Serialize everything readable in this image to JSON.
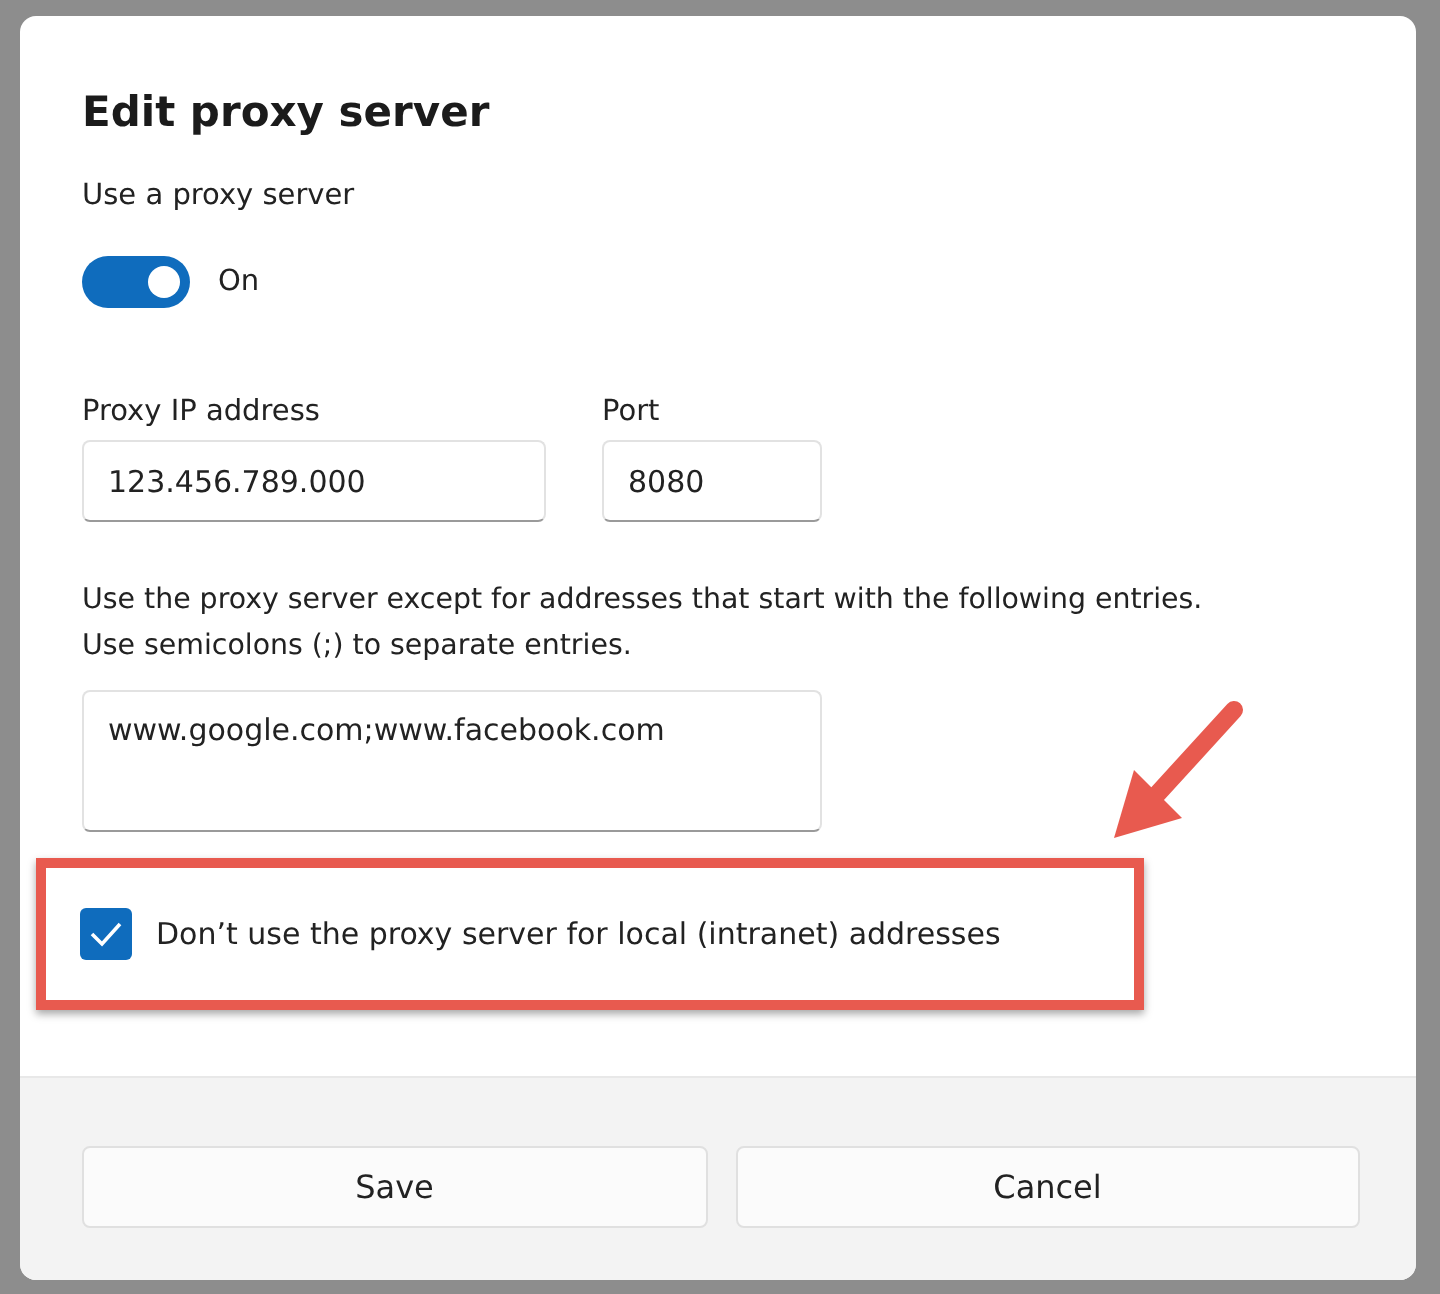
{
  "dialog": {
    "title": "Edit proxy server",
    "proxy_toggle": {
      "label": "Use a proxy server",
      "on": true,
      "state_text": "On"
    },
    "fields": [
      {
        "label": "Proxy IP address",
        "value": "123.456.789.000"
      },
      {
        "label": "Port",
        "value": "8080"
      }
    ],
    "exceptions": {
      "description_lines": [
        "Use the proxy server except for addresses that start with the following entries.",
        "Use semicolons (;) to separate entries."
      ],
      "value": "www.google.com;www.facebook.com"
    },
    "local_bypass": {
      "label": "Don’t use the proxy server for local (intranet) addresses",
      "checked": true
    },
    "buttons": [
      "Save",
      "Cancel"
    ]
  }
}
